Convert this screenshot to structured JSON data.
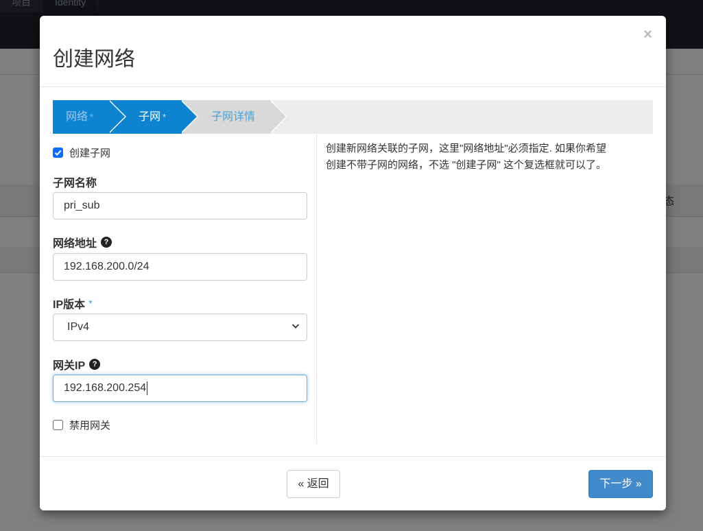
{
  "background": {
    "tabs": [
      "项目",
      "Identity"
    ],
    "column_header_fragment": "态"
  },
  "modal": {
    "title": "创建网络",
    "close_label": "×"
  },
  "wizard": {
    "steps": [
      {
        "label": "网络",
        "required_mark": "*",
        "state": "completed"
      },
      {
        "label": "子网",
        "required_mark": "*",
        "state": "active"
      },
      {
        "label": "子网详情",
        "required_mark": "",
        "state": "pending"
      }
    ]
  },
  "form": {
    "create_subnet": {
      "label": "创建子网",
      "checked": true
    },
    "subnet_name": {
      "label": "子网名称",
      "value": "pri_sub"
    },
    "network_address": {
      "label": "网络地址",
      "help_icon": "question-circle-icon",
      "value": "192.168.200.0/24"
    },
    "ip_version": {
      "label": "IP版本",
      "required_mark": "*",
      "selected": "IPv4"
    },
    "gateway_ip": {
      "label": "网关IP",
      "help_icon": "question-circle-icon",
      "value": "192.168.200.254"
    },
    "disable_gateway": {
      "label": "禁用网关",
      "checked": false
    }
  },
  "help_text": "创建新网络关联的子网，这里\"网络地址\"必须指定. 如果你希望创建不带子网的网络，不选 \"创建子网\" 这个复选框就可以了。",
  "footer": {
    "back_label": "« 返回",
    "next_label": "下一步 »"
  },
  "colors": {
    "step_active": "#0e84d1",
    "step_pending": "#d9d9d9",
    "primary_button": "#428bca",
    "checkbox_checked": "#0d6efd"
  }
}
